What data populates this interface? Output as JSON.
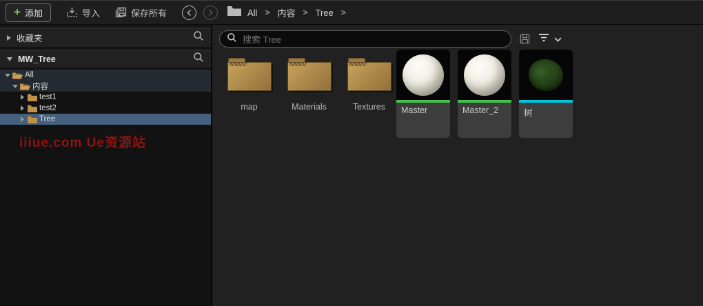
{
  "toolbar": {
    "add_label": "添加",
    "import_label": "导入",
    "save_all_label": "保存所有",
    "breadcrumb": [
      {
        "label": "All"
      },
      {
        "label": "内容"
      },
      {
        "label": "Tree"
      }
    ]
  },
  "sidebar": {
    "favorites_label": "收藏夹",
    "collection_label": "MW_Tree",
    "tree": [
      {
        "label": "All",
        "depth": 0,
        "expanded": true,
        "folder": "open",
        "state": "band"
      },
      {
        "label": "内容",
        "depth": 1,
        "expanded": true,
        "folder": "open",
        "state": "band"
      },
      {
        "label": "test1",
        "depth": 2,
        "expanded": false,
        "folder": "closed",
        "state": "none"
      },
      {
        "label": "test2",
        "depth": 2,
        "expanded": false,
        "folder": "closed",
        "state": "none"
      },
      {
        "label": "Tree",
        "depth": 2,
        "expanded": false,
        "folder": "closed",
        "state": "selected"
      }
    ],
    "watermark": "iiiue.com  Ue资源站"
  },
  "main": {
    "search_placeholder": "搜索 Tree",
    "folders": [
      {
        "name": "map"
      },
      {
        "name": "Materials"
      },
      {
        "name": "Textures"
      }
    ],
    "assets": [
      {
        "name": "Master",
        "type": "material",
        "thumb": "sphere",
        "bar_color": "#45c14b"
      },
      {
        "name": "Master_2",
        "type": "material",
        "thumb": "sphere",
        "bar_color": "#45c14b"
      },
      {
        "name": "树",
        "type": "static-mesh",
        "thumb": "tree",
        "bar_color": "#00c4e0"
      }
    ]
  },
  "colors": {
    "accent_green": "#8bc34a",
    "selection_blue": "#44607e",
    "material_bar": "#45c14b",
    "static_mesh_bar": "#00c4e0",
    "watermark_red": "#8e1313"
  }
}
